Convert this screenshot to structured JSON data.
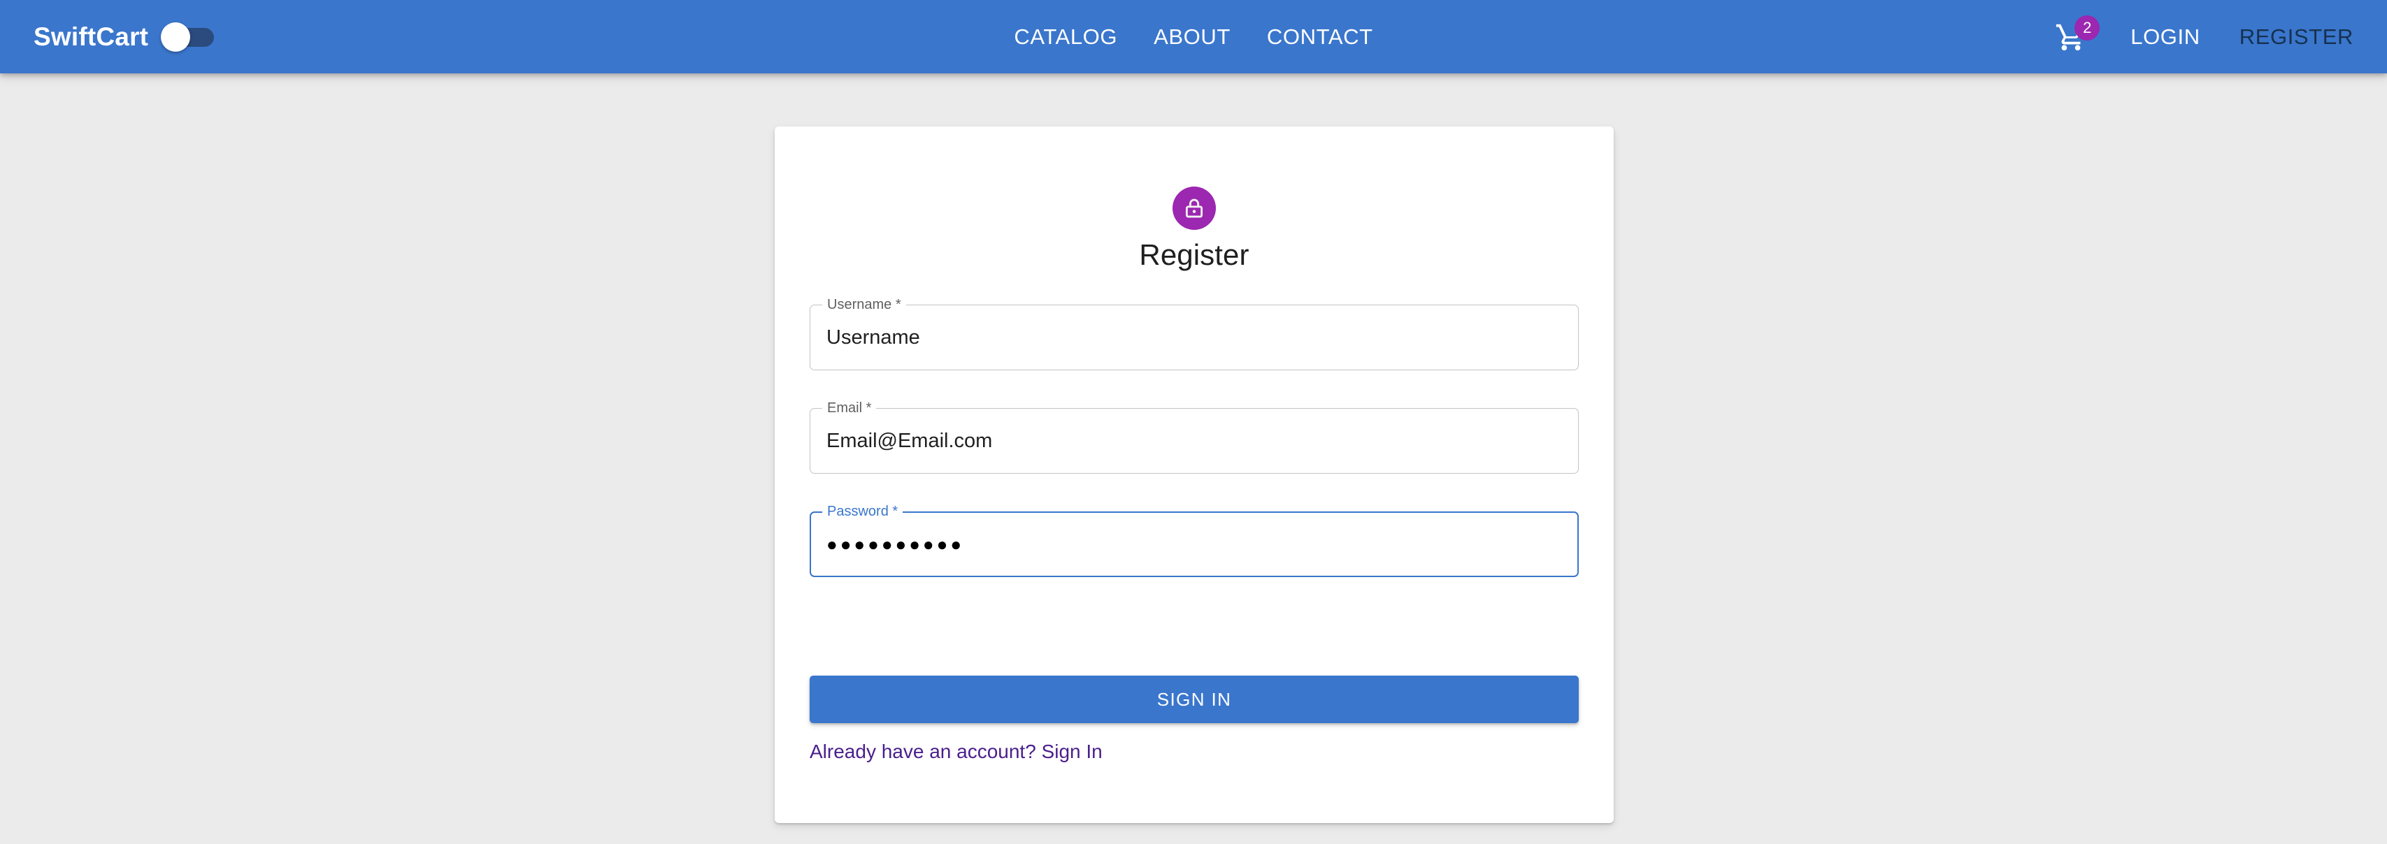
{
  "appbar": {
    "brand": "SwiftCart",
    "theme_toggle": {
      "name": "theme-toggle",
      "state": "off"
    },
    "nav_links": [
      {
        "label": "CATALOG"
      },
      {
        "label": "ABOUT"
      },
      {
        "label": "CONTACT"
      }
    ],
    "cart": {
      "icon": "shopping-cart-icon",
      "badge_count": "2",
      "badge_color": "#9c27b0"
    },
    "auth_links": [
      {
        "label": "LOGIN",
        "active": false
      },
      {
        "label": "REGISTER",
        "active": true
      }
    ],
    "background_color": "#3a76cc"
  },
  "card": {
    "avatar_icon": "lock-icon",
    "avatar_color": "#9c27b0",
    "title": "Register",
    "fields": [
      {
        "label": "Username *",
        "value": "Username",
        "placeholder": "Username",
        "focused": false,
        "masked": false
      },
      {
        "label": "Email *",
        "value": "Email@Email.com",
        "placeholder": "Email",
        "focused": false,
        "masked": false
      },
      {
        "label": "Password *",
        "value": "●●●●●●●●●●",
        "placeholder": "Password",
        "focused": true,
        "masked": true
      }
    ],
    "submit_label": "SIGN IN",
    "submit_color": "#3a76cc",
    "signin_link": "Already have an account? Sign In",
    "signin_link_color": "#4a1e8c"
  },
  "page": {
    "background_color": "#ebebeb"
  }
}
